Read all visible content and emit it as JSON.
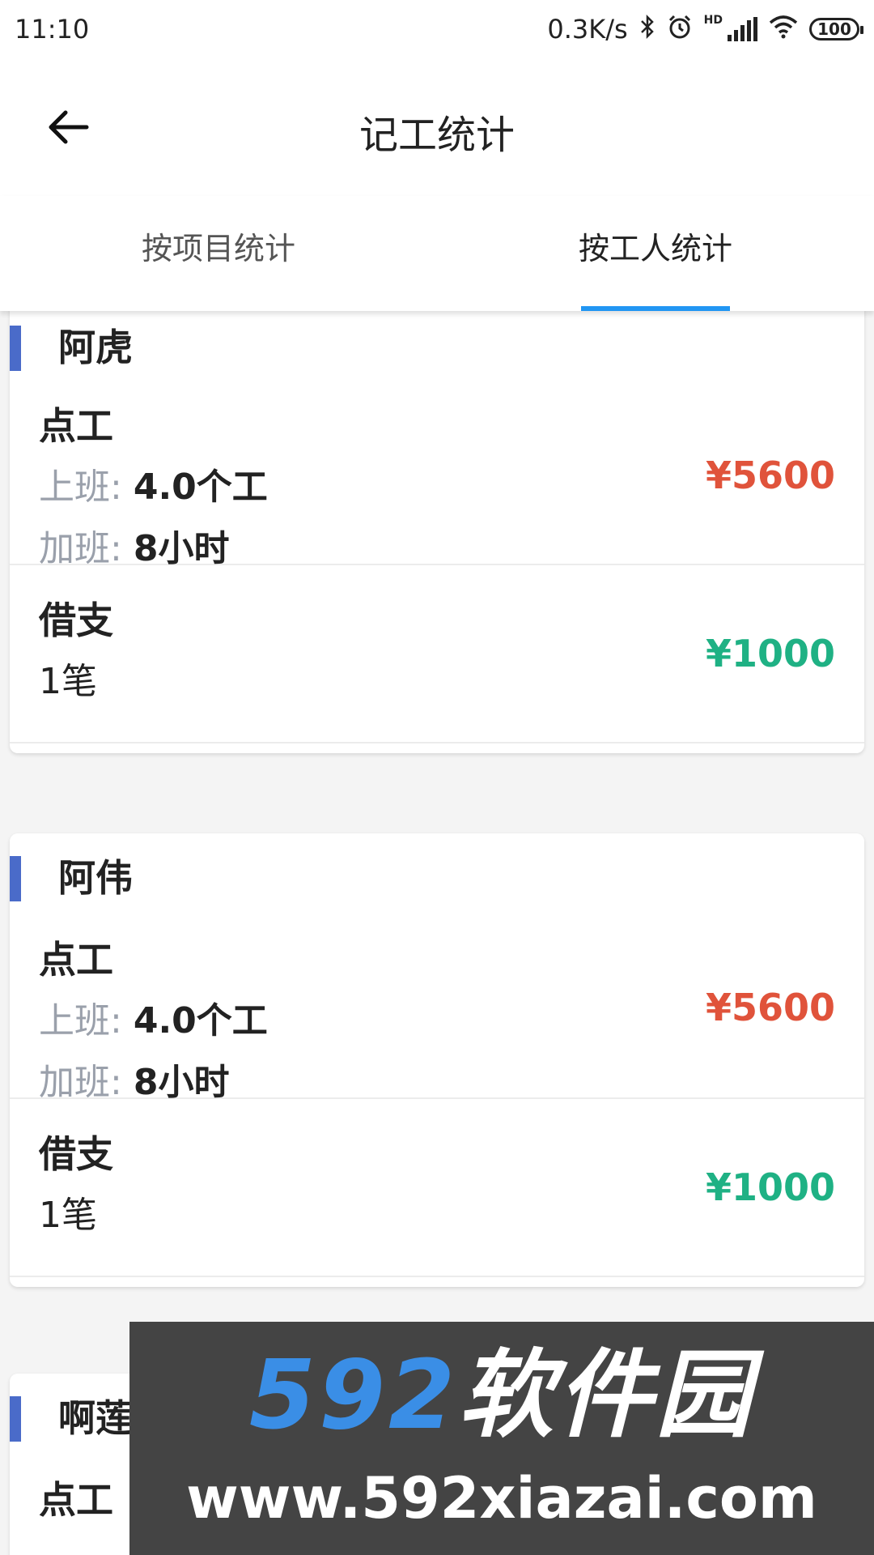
{
  "status_bar": {
    "time": "11:10",
    "net_speed": "0.3K/s",
    "hd_label": "HD",
    "battery": "100",
    "icons": [
      "bluetooth-icon",
      "alarm-icon",
      "signal-icon",
      "wifi-icon",
      "battery-icon"
    ]
  },
  "app_bar": {
    "title": "记工统计",
    "back_icon": "arrow-left-icon"
  },
  "tabs": [
    {
      "label": "按项目统计",
      "active": false
    },
    {
      "label": "按工人统计",
      "active": true
    }
  ],
  "workers": [
    {
      "name": "阿虎",
      "point_work": {
        "title": "点工",
        "work_label": "上班:",
        "work_value": "4.0个工",
        "overtime_label": "加班:",
        "overtime_value": "8小时",
        "amount": "¥5600"
      },
      "loan": {
        "title": "借支",
        "count": "1笔",
        "amount": "¥1000"
      }
    },
    {
      "name": "阿伟",
      "point_work": {
        "title": "点工",
        "work_label": "上班:",
        "work_value": "4.0个工",
        "overtime_label": "加班:",
        "overtime_value": "8小时",
        "amount": "¥5600"
      },
      "loan": {
        "title": "借支",
        "count": "1笔",
        "amount": "¥1000"
      }
    },
    {
      "name": "啊莲",
      "point_work": {
        "title": "点工"
      }
    }
  ],
  "watermark": {
    "logo_number": "592",
    "logo_text": "软件园",
    "url": "www.592xiazai.com"
  },
  "colors": {
    "accent_blue": "#2196f3",
    "card_bar": "#4a6bc9",
    "amount_red": "#e0533b",
    "amount_green": "#1fb184"
  }
}
